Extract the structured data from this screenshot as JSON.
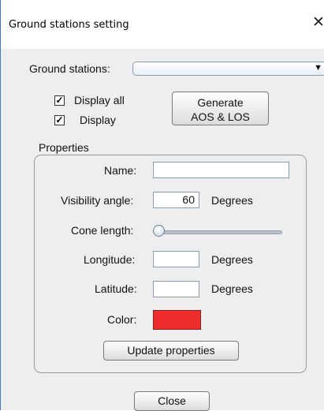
{
  "window": {
    "title": "Ground stations setting",
    "close_glyph": "✕"
  },
  "stations": {
    "label": "Ground stations:",
    "selected": ""
  },
  "display_all": {
    "label": "Display all",
    "checked": true
  },
  "display": {
    "label": "Display",
    "checked": true
  },
  "generate_button": {
    "line1": "Generate",
    "line2": "AOS & LOS"
  },
  "properties": {
    "title": "Properties",
    "name_label": "Name:",
    "name_value": "",
    "visibility_label": "Visibility angle:",
    "visibility_value": "60",
    "visibility_unit": "Degrees",
    "cone_label": "Cone length:",
    "cone_level": 0,
    "longitude_label": "Longitude:",
    "longitude_value": "",
    "longitude_unit": "Degrees",
    "latitude_label": "Latitude:",
    "latitude_value": "",
    "latitude_unit": "Degrees",
    "color_label": "Color:",
    "color_value": "#ee2c2c",
    "update_button": "Update properties"
  },
  "close_button": "Close"
}
